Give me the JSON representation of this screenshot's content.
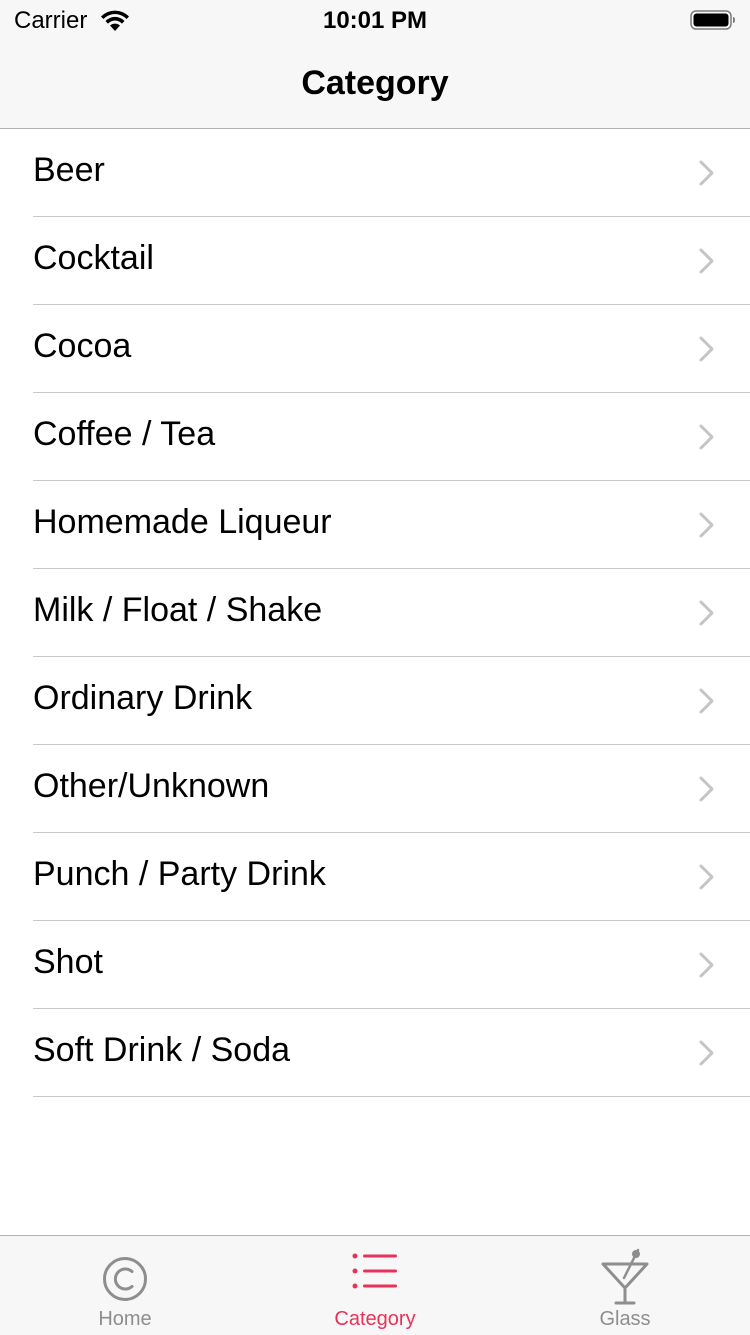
{
  "status_bar": {
    "carrier": "Carrier",
    "time": "10:01 PM"
  },
  "nav": {
    "title": "Category"
  },
  "categories": [
    {
      "label": "Beer"
    },
    {
      "label": "Cocktail"
    },
    {
      "label": "Cocoa"
    },
    {
      "label": "Coffee / Tea"
    },
    {
      "label": "Homemade Liqueur"
    },
    {
      "label": "Milk / Float / Shake"
    },
    {
      "label": "Ordinary Drink"
    },
    {
      "label": "Other/Unknown"
    },
    {
      "label": "Punch / Party Drink"
    },
    {
      "label": "Shot"
    },
    {
      "label": "Soft Drink / Soda"
    }
  ],
  "tabs": [
    {
      "label": "Home",
      "icon": "copyright-circle-icon",
      "active": false
    },
    {
      "label": "Category",
      "icon": "list-icon",
      "active": true
    },
    {
      "label": "Glass",
      "icon": "cocktail-glass-icon",
      "active": false
    }
  ],
  "colors": {
    "accent": "#e8325a",
    "inactive": "#8e8e8e",
    "separator": "#c8c7cc",
    "bar_background": "#f7f7f7"
  }
}
